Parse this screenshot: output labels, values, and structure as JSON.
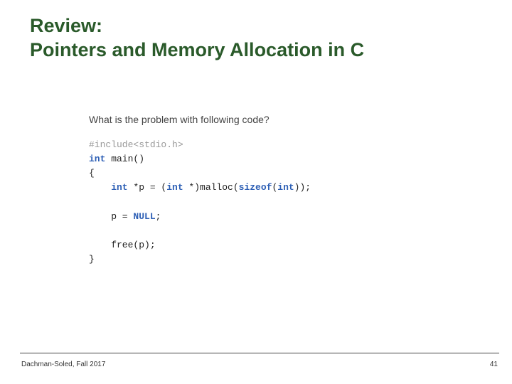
{
  "title_line1": "Review:",
  "title_line2": "Pointers and Memory Allocation in C",
  "question": "What is the problem with following code?",
  "code": {
    "l1a": "#include",
    "l1b": "<stdio.h>",
    "l2a": "int",
    "l2b": " main()",
    "l3": "{",
    "l4a": "    int",
    "l4b": " *p = (",
    "l4c": "int",
    "l4d": " *)malloc(",
    "l4e": "sizeof",
    "l4f": "(",
    "l4g": "int",
    "l4h": "));",
    "l5": " ",
    "l6a": "    p = ",
    "l6b": "NULL",
    "l6c": ";",
    "l7": " ",
    "l8": "    free(p);",
    "l9": "}"
  },
  "footer": {
    "left": "Dachman-Soled, Fall 2017",
    "right": "41"
  }
}
